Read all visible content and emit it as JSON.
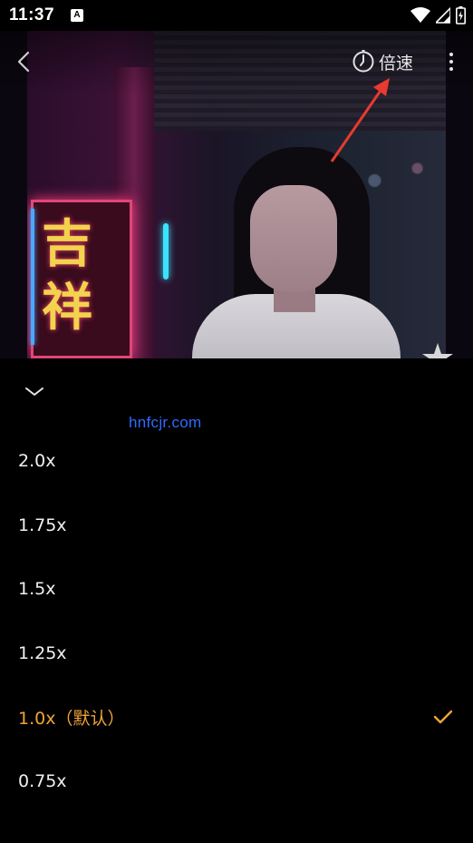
{
  "status_bar": {
    "time": "11:37",
    "app_icon": "A"
  },
  "video": {
    "speed_button_label": "倍速",
    "sign_chars": "吉祥"
  },
  "panel": {
    "watermark": "hnfcjr.com",
    "options": [
      {
        "label": "2.0x",
        "selected": false
      },
      {
        "label": "1.75x",
        "selected": false
      },
      {
        "label": "1.5x",
        "selected": false
      },
      {
        "label": "1.25x",
        "selected": false
      },
      {
        "label": "1.0x（默认）",
        "selected": true
      },
      {
        "label": "0.75x",
        "selected": false
      }
    ]
  },
  "colors": {
    "accent": "#f0a437",
    "watermark": "#2f6bff",
    "arrow": "#e83a2f"
  },
  "icons": [
    "back-icon",
    "speed-icon",
    "more-icon",
    "collapse-icon",
    "check-icon",
    "star-icon",
    "wifi-icon",
    "signal-icon",
    "battery-icon"
  ]
}
